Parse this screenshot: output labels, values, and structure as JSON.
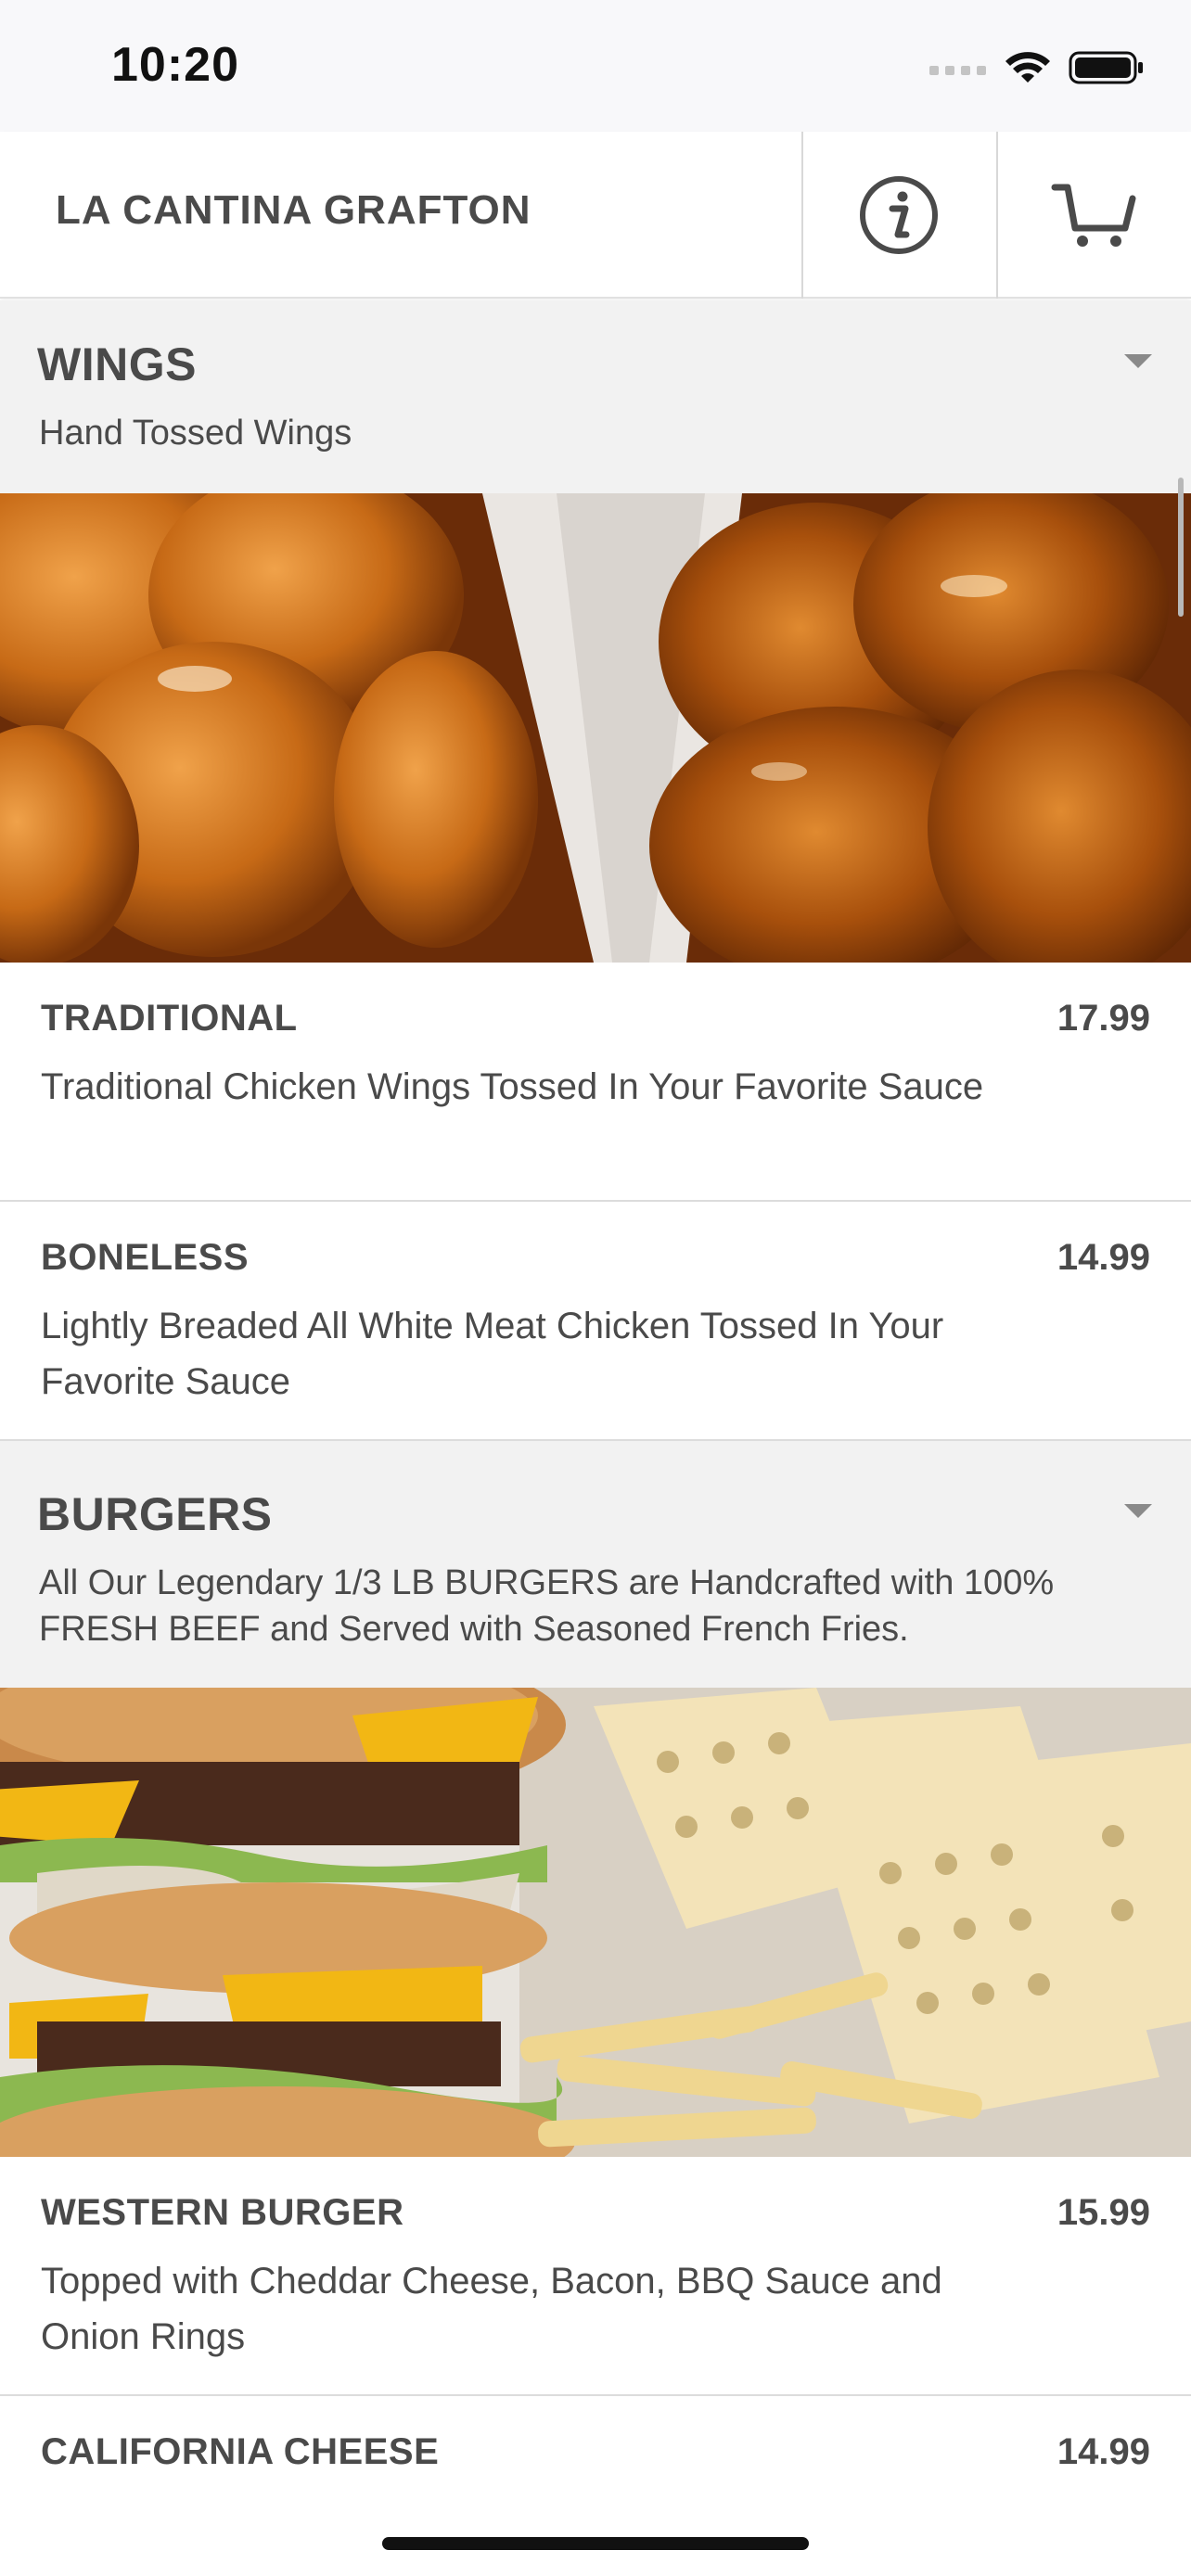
{
  "status_bar": {
    "time": "10:20"
  },
  "header": {
    "title": "LA CANTINA GRAFTON",
    "info_icon": "info-icon",
    "cart_icon": "cart-icon"
  },
  "sections": [
    {
      "title": "WINGS",
      "description": "Hand Tossed Wings",
      "items": [
        {
          "name": "TRADITIONAL",
          "price": "17.99",
          "description": "Traditional Chicken Wings Tossed In Your Favorite Sauce"
        },
        {
          "name": "BONELESS",
          "price": "14.99",
          "description": "Lightly Breaded All White Meat Chicken Tossed In Your Favorite Sauce"
        }
      ]
    },
    {
      "title": "BURGERS",
      "description": "All Our Legendary 1/3 LB BURGERS are Handcrafted with 100% FRESH BEEF and Served with Seasoned French Fries.",
      "items": [
        {
          "name": "WESTERN BURGER",
          "price": "15.99",
          "description": "Topped with Cheddar Cheese, Bacon, BBQ Sauce and Onion Rings"
        },
        {
          "name": "CALIFORNIA CHEESE",
          "price": "14.99",
          "description": ""
        }
      ]
    }
  ],
  "colors": {
    "section_bg": "#f2f2f2",
    "text": "#4a4a4a",
    "divider": "#dcdcdc"
  }
}
